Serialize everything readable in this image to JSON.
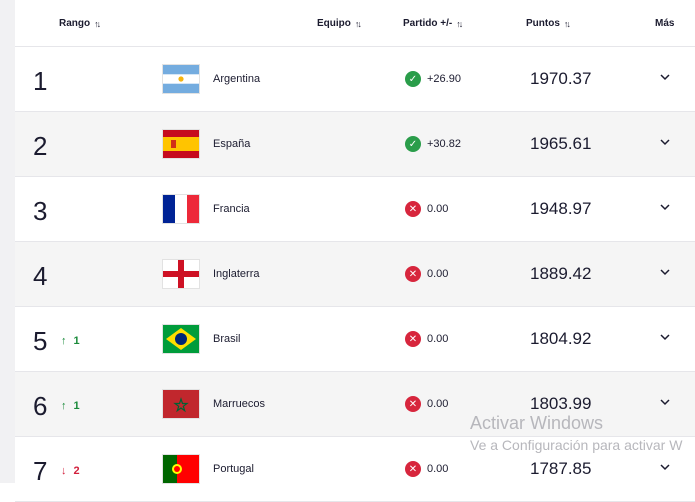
{
  "header": {
    "rank_label": "Rango",
    "team_label": "Equipo",
    "match_label": "Partido +/-",
    "points_label": "Puntos",
    "more_label": "Más"
  },
  "rows": [
    {
      "rank": "1",
      "move": "",
      "move_dir": "",
      "team": "Argentina",
      "flag": "argentina-flag-icon",
      "match_status": "ok",
      "match_value": "+26.90",
      "points": "1970.37"
    },
    {
      "rank": "2",
      "move": "",
      "move_dir": "",
      "team": "España",
      "flag": "spain-flag-icon",
      "match_status": "ok",
      "match_value": "+30.82",
      "points": "1965.61"
    },
    {
      "rank": "3",
      "move": "",
      "move_dir": "",
      "team": "Francia",
      "flag": "france-flag-icon",
      "match_status": "bad",
      "match_value": "0.00",
      "points": "1948.97"
    },
    {
      "rank": "4",
      "move": "",
      "move_dir": "",
      "team": "Inglaterra",
      "flag": "england-flag-icon",
      "match_status": "bad",
      "match_value": "0.00",
      "points": "1889.42"
    },
    {
      "rank": "5",
      "move": "1",
      "move_dir": "up",
      "team": "Brasil",
      "flag": "brazil-flag-icon",
      "match_status": "bad",
      "match_value": "0.00",
      "points": "1804.92"
    },
    {
      "rank": "6",
      "move": "1",
      "move_dir": "up",
      "team": "Marruecos",
      "flag": "morocco-flag-icon",
      "match_status": "bad",
      "match_value": "0.00",
      "points": "1803.99"
    },
    {
      "rank": "7",
      "move": "2",
      "move_dir": "down",
      "team": "Portugal",
      "flag": "portugal-flag-icon",
      "match_status": "bad",
      "match_value": "0.00",
      "points": "1787.85"
    }
  ],
  "watermark": {
    "line1": "Activar Windows",
    "line2": "Ve a Configuración para activar W"
  },
  "colors": {
    "ok": "#2a9d4a",
    "bad": "#d7263d",
    "up": "#1a8a3a",
    "down": "#d21f3c"
  }
}
